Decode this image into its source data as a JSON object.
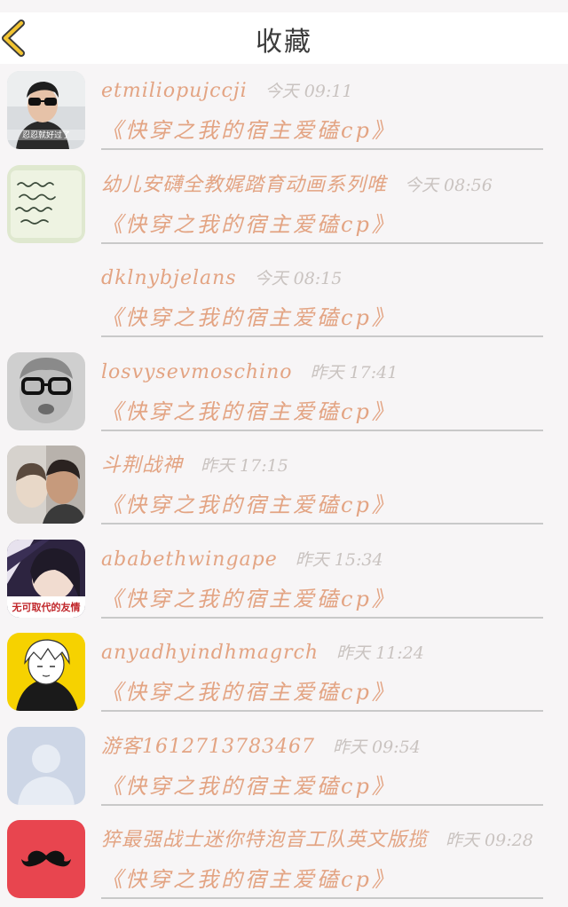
{
  "header": {
    "title": "收藏",
    "back_icon": "chevron-left-icon",
    "accent_color": "#f2c432"
  },
  "items": [
    {
      "name": "etmiliopujccji",
      "time": "今天 09:11",
      "book": "《快穿之我的宿主爱磕cp》",
      "avatar": "photo-avatar",
      "avatar_text": "忍忍就好过了"
    },
    {
      "name": "幼儿安礴全教娓踏育动画系列唯",
      "time": "今天 08:56",
      "book": "《快穿之我的宿主爱磕cp》",
      "avatar": "handwriting-note-avatar"
    },
    {
      "name": "dklnybjelans",
      "time": "今天 08:15",
      "book": "《快穿之我的宿主爱磕cp》",
      "avatar": "none"
    },
    {
      "name": "losvysevmoschino",
      "time": "昨天 17:41",
      "book": "《快穿之我的宿主爱磕cp》",
      "avatar": "glasses-child-avatar"
    },
    {
      "name": "斗荆战神",
      "time": "昨天 17:15",
      "book": "《快穿之我的宿主爱磕cp》",
      "avatar": "couple-photo-avatar"
    },
    {
      "name": "ababethwingape",
      "time": "昨天 15:34",
      "book": "《快穿之我的宿主爱磕cp》",
      "avatar": "girl-photo-avatar",
      "avatar_text": "无可取代的友情"
    },
    {
      "name": "anyadhyindhmagrch",
      "time": "昨天 11:24",
      "book": "《快穿之我的宿主爱磕cp》",
      "avatar": "anime-boy-avatar"
    },
    {
      "name": "游客1612713783467",
      "time": "昨天 09:54",
      "book": "《快穿之我的宿主爱磕cp》",
      "avatar": "default-user-avatar"
    },
    {
      "name": "猝最强战士迷你特泡音工队英文版揽",
      "time": "昨天 09:28",
      "book": "《快穿之我的宿主爱磕cp》",
      "avatar": "mustache-avatar"
    }
  ]
}
